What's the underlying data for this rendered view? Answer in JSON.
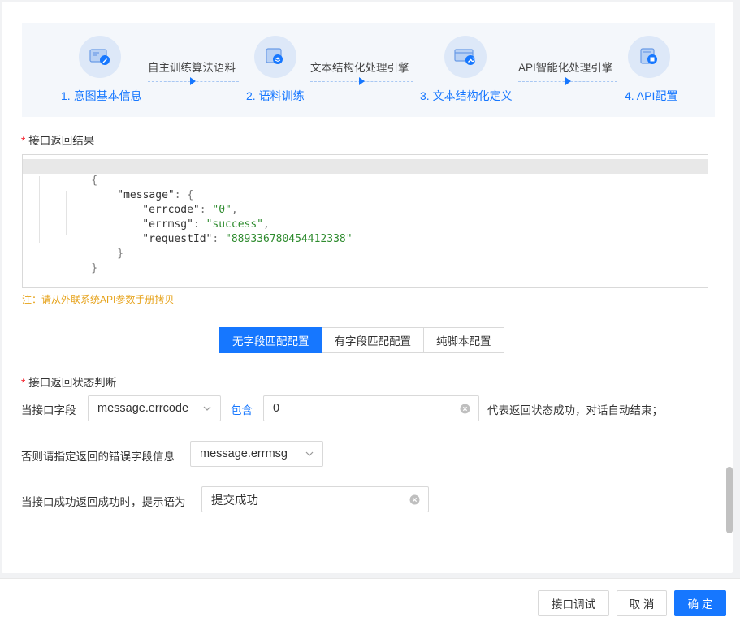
{
  "steps": [
    {
      "label": "1. 意图基本信息",
      "icon": "edit-doc-icon"
    },
    {
      "label": "2. 语料训练",
      "icon": "layers-doc-icon"
    },
    {
      "label": "3. 文本结构化定义",
      "icon": "wrench-monitor-icon"
    },
    {
      "label": "4. API配置",
      "icon": "api-doc-icon"
    }
  ],
  "connectors": [
    "自主训练算法语料",
    "文本结构化处理引擎",
    "API智能化处理引擎"
  ],
  "response_section": {
    "title": "接口返回结果"
  },
  "code": {
    "lines": [
      "{",
      "\"message\": {",
      "\"errcode\": \"0\",",
      "\"errmsg\": \"success\",",
      "\"requestId\": \"889336780454412338\"",
      "}",
      "}"
    ]
  },
  "note": "注：请从外联系统API参数手册拷贝",
  "config_tabs": [
    {
      "label": "无字段匹配配置",
      "active": true
    },
    {
      "label": "有字段匹配配置",
      "active": false
    },
    {
      "label": "纯脚本配置",
      "active": false
    }
  ],
  "status_section": {
    "title": "接口返回状态判断"
  },
  "row1": {
    "prefix": "当接口字段",
    "field_value": "message.errcode",
    "operator": "包含",
    "input_value": "0",
    "suffix": "代表返回状态成功，对话自动结束；"
  },
  "row2": {
    "prefix": "否则请指定返回的错误字段信息",
    "field_value": "message.errmsg"
  },
  "row3": {
    "prefix": "当接口成功返回成功时，提示语为",
    "input_value": "提交成功"
  },
  "footer": {
    "debug_label": "接口调试",
    "cancel_label": "取 消",
    "confirm_label": "确 定"
  },
  "colors": {
    "primary": "#1677ff",
    "required": "#f5222d",
    "note": "#e6a117"
  }
}
